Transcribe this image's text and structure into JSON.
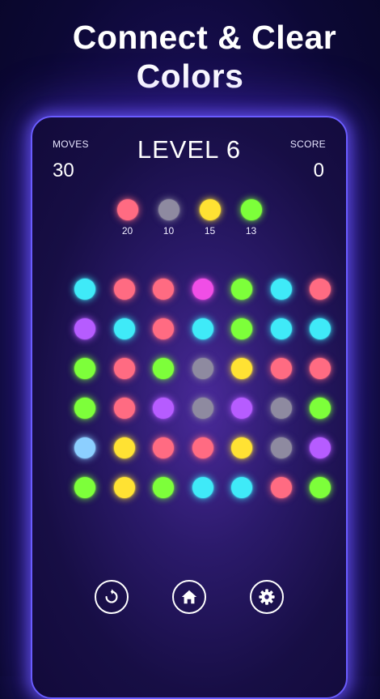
{
  "headline": {
    "line1": "Connect & Clear",
    "line2": "Colors"
  },
  "stats": {
    "moves_label": "MOVES",
    "moves_value": "30",
    "score_label": "SCORE",
    "score_value": "0"
  },
  "level": "LEVEL 6",
  "colors": {
    "pink": "#ff6b82",
    "gray": "#8e8aa0",
    "yellow": "#ffe233",
    "green": "#7dff3a",
    "cyan": "#3feaf8",
    "magenta": "#f04ee6",
    "purple": "#b65cff",
    "lightblue": "#8ccfff"
  },
  "goals": [
    {
      "color": "pink",
      "count": "20"
    },
    {
      "color": "gray",
      "count": "10"
    },
    {
      "color": "yellow",
      "count": "15"
    },
    {
      "color": "green",
      "count": "13"
    }
  ],
  "board": [
    [
      "cyan",
      "pink",
      "pink",
      "magenta",
      "green",
      "cyan",
      "pink"
    ],
    [
      "purple",
      "cyan",
      "pink",
      "cyan",
      "green",
      "cyan",
      "cyan"
    ],
    [
      "green",
      "pink",
      "green",
      "gray",
      "yellow",
      "pink",
      "pink"
    ],
    [
      "green",
      "pink",
      "purple",
      "gray",
      "purple",
      "gray",
      "green"
    ],
    [
      "lightblue",
      "yellow",
      "pink",
      "pink",
      "yellow",
      "gray",
      "purple"
    ],
    [
      "green",
      "yellow",
      "green",
      "cyan",
      "cyan",
      "pink",
      "green"
    ]
  ],
  "buttons": {
    "undo_icon": "undo-icon",
    "home_icon": "home-icon",
    "settings_icon": "gear-icon"
  }
}
